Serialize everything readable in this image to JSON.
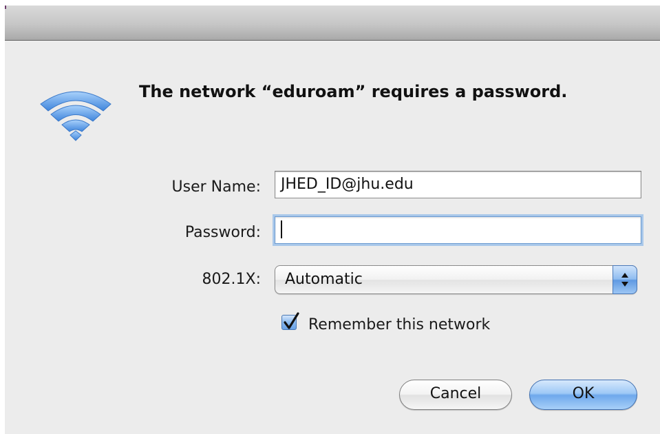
{
  "dialog": {
    "message": "The network “eduroam” requires a password.",
    "icon": "wifi-icon"
  },
  "form": {
    "username_label": "User Name:",
    "username_value": "JHED_ID@jhu.edu",
    "password_label": "Password:",
    "password_value": "",
    "security_label": "802.1X:",
    "security_value": "Automatic",
    "remember_label": "Remember this network",
    "remember_checked": true
  },
  "buttons": {
    "cancel_label": "Cancel",
    "ok_label": "OK"
  },
  "colors": {
    "accent": "#6ea8ec",
    "wifi": "#4b8fe0",
    "window_bg": "#ececec"
  }
}
